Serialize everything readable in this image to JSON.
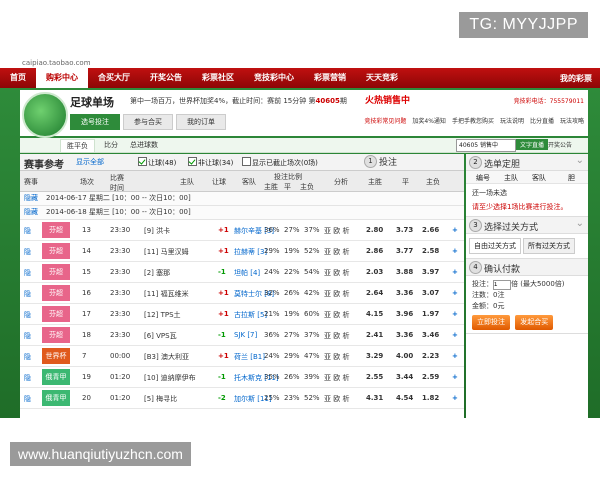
{
  "watermarks": {
    "top": "TG: MYYJJPP",
    "bottom": "www.huanqiutiyuzhcn.com"
  },
  "site": {
    "url": "caipiao.taobao.com"
  },
  "nav": {
    "items": [
      "首页",
      "购彩中心",
      "合买大厅",
      "开奖公告",
      "彩票社区",
      "竞技彩中心",
      "彩票营销",
      "天天竞彩"
    ],
    "active_index": 1,
    "account": "我的彩票"
  },
  "header": {
    "title": "足球单场",
    "info_prefix": "第中一场百万，世界杯加奖4%，截止时间：赛前 15分钟 第",
    "issue": "40605",
    "info_suffix": "期",
    "hot": "火热销售中",
    "phone": "竞技彩电话：755579011",
    "tabs": [
      "选号投注",
      "参与合买",
      "我的订单"
    ],
    "links": [
      "竞技彩常见问题",
      "加奖4%通知",
      "手把手教您购买",
      "玩法说明",
      "比分直播",
      "玩法攻略"
    ]
  },
  "toolbar": {
    "tabs": [
      "胜平负",
      "比分",
      "总进球数"
    ],
    "issue_select": "40605 销售中",
    "btn": "文字直播",
    "link": "开奖公告"
  },
  "match_list": {
    "title": "赛事参考",
    "show_all": "显示全部",
    "filters": [
      {
        "label": "让球(48)",
        "checked": true
      },
      {
        "label": "非让球(34)",
        "checked": true
      },
      {
        "label": "显示已截止场次(0场)",
        "checked": false
      }
    ],
    "step_num": "1",
    "step_label": "投注",
    "columns": [
      "赛事",
      "场次",
      "比赛时间",
      "主队",
      "让球",
      "客队",
      "投注比例",
      "主胜",
      "平",
      "主负",
      "分析",
      "主胜",
      "平",
      "主负"
    ],
    "date_rows": [
      {
        "hide": "隐藏",
        "date": "2014-06-17 星期二 [10：00 -- 次日10：00]"
      },
      {
        "hide": "隐藏",
        "date": "2014-06-18 星期三 [10：00 -- 次日10：00]"
      }
    ],
    "matches": [
      {
        "hide": "隐",
        "league": "芬超",
        "league_color": "#e8658a",
        "no": "13",
        "time": "23:30",
        "home": "[9] 洪卡",
        "hc": "+1",
        "hc_class": "neg",
        "away": "赫尔辛基 [3]",
        "p1": "36%",
        "p2": "27%",
        "p3": "37%",
        "analysis": "亚 欧 析",
        "o1": "2.80",
        "o2": "3.73",
        "o3": "2.66",
        "plus": "+"
      },
      {
        "hide": "隐",
        "league": "芬超",
        "league_color": "#e8658a",
        "no": "14",
        "time": "23:30",
        "home": "[11] 马里汉姆",
        "hc": "+1",
        "hc_class": "neg",
        "away": "拉赫蒂 [3]",
        "p1": "29%",
        "p2": "19%",
        "p3": "52%",
        "analysis": "亚 欧 析",
        "o1": "2.86",
        "o2": "3.77",
        "o3": "2.58",
        "plus": "+"
      },
      {
        "hide": "隐",
        "league": "芬超",
        "league_color": "#e8658a",
        "no": "15",
        "time": "23:30",
        "home": "[2] 塞那",
        "hc": "-1",
        "hc_class": "pos",
        "away": "坦帕 [4]",
        "p1": "24%",
        "p2": "22%",
        "p3": "54%",
        "analysis": "亚 欧 析",
        "o1": "2.03",
        "o2": "3.88",
        "o3": "3.97",
        "plus": "+"
      },
      {
        "hide": "隐",
        "league": "芬超",
        "league_color": "#e8658a",
        "no": "16",
        "time": "23:30",
        "home": "[11] 福瓦维米",
        "hc": "+1",
        "hc_class": "neg",
        "away": "莫特士尔 [8]",
        "p1": "32%",
        "p2": "26%",
        "p3": "42%",
        "analysis": "亚 欧 析",
        "o1": "2.64",
        "o2": "3.36",
        "o3": "3.07",
        "plus": "+"
      },
      {
        "hide": "隐",
        "league": "芬超",
        "league_color": "#e8658a",
        "no": "17",
        "time": "23:30",
        "home": "[12] TPS土",
        "hc": "+1",
        "hc_class": "neg",
        "away": "古拉斯 [5]",
        "p1": "21%",
        "p2": "19%",
        "p3": "60%",
        "analysis": "亚 欧 析",
        "o1": "4.15",
        "o2": "3.96",
        "o3": "1.97",
        "plus": "+"
      },
      {
        "hide": "隐",
        "league": "芬超",
        "league_color": "#e8658a",
        "no": "18",
        "time": "23:30",
        "home": "[6] VPS瓦",
        "hc": "-1",
        "hc_class": "pos",
        "away": "SJK [7]",
        "p1": "36%",
        "p2": "27%",
        "p3": "37%",
        "analysis": "亚 欧 析",
        "o1": "2.41",
        "o2": "3.36",
        "o3": "3.46",
        "plus": "+"
      },
      {
        "hide": "隐",
        "league": "世界杯",
        "league_color": "#e05a1c",
        "no": "7",
        "time": "00:00",
        "home": "[B3] 澳大利亚",
        "hc": "+1",
        "hc_class": "neg",
        "away": "荷兰 [B1]",
        "p1": "24%",
        "p2": "29%",
        "p3": "47%",
        "analysis": "亚 欧 析",
        "o1": "3.29",
        "o2": "4.00",
        "o3": "2.23",
        "plus": "+"
      },
      {
        "hide": "隐",
        "league": "俄青甲",
        "league_color": "#3cb872",
        "no": "19",
        "time": "01:20",
        "home": "[10] 迪纳摩伊布",
        "hc": "-1",
        "hc_class": "pos",
        "away": "托木斯克 [11]",
        "p1": "35%",
        "p2": "26%",
        "p3": "39%",
        "analysis": "亚 欧 析",
        "o1": "2.55",
        "o2": "3.44",
        "o3": "2.59",
        "plus": "+"
      },
      {
        "hide": "隐",
        "league": "俄青甲",
        "league_color": "#3cb872",
        "no": "20",
        "time": "01:20",
        "home": "[5] 梅寻比",
        "hc": "-2",
        "hc_class": "pos",
        "away": "加尔斯 [11]",
        "p1": "25%",
        "p2": "23%",
        "p3": "52%",
        "analysis": "亚 欧 析",
        "o1": "4.31",
        "o2": "4.54",
        "o3": "1.82",
        "plus": "+"
      }
    ]
  },
  "sidebar": {
    "selection": {
      "num": "2",
      "title": "选单定胆",
      "cols": [
        "编号",
        "主队",
        "客队",
        "胆"
      ],
      "text": "还一场未选",
      "warn": "请至少选择1场比赛进行投注。"
    },
    "combo": {
      "num": "3",
      "title": "选择过关方式",
      "tabs": [
        "自由过关方式",
        "所有过关方式"
      ]
    },
    "pay": {
      "num": "4",
      "title": "确认付款",
      "multi_label": "投注：",
      "multi_value": "1",
      "multi_suffix": "倍 (最大5000倍)",
      "line2": "注数：0注",
      "line3": "金额：0元",
      "btn1": "立即投注",
      "btn2": "发起合买"
    }
  }
}
